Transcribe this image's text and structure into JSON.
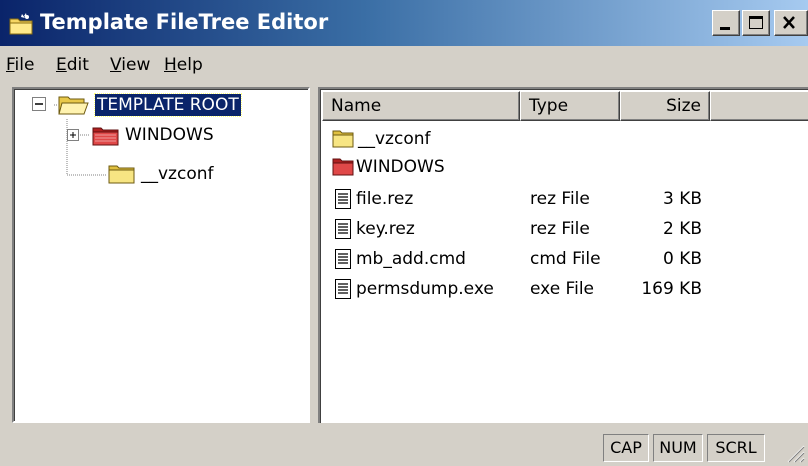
{
  "window": {
    "title": "Template FileTree Editor",
    "controls": {
      "minimize": "minimize",
      "maximize": "maximize",
      "close": "close"
    }
  },
  "menu": [
    {
      "label": "File",
      "hotkey": "F",
      "rest": "ile"
    },
    {
      "label": "Edit",
      "hotkey": "E",
      "rest": "dit"
    },
    {
      "label": "View",
      "hotkey": "V",
      "rest": "iew"
    },
    {
      "label": "Help",
      "hotkey": "H",
      "rest": "elp"
    }
  ],
  "tree": {
    "root": {
      "label": "TEMPLATE ROOT",
      "expanded": true,
      "selected": true,
      "icon": "folder-open-icon"
    },
    "children": [
      {
        "label": "WINDOWS",
        "expandable": true,
        "icon": "folder-red-icon"
      },
      {
        "label": "__vzconf",
        "expandable": false,
        "icon": "folder-icon"
      }
    ]
  },
  "list": {
    "columns": [
      {
        "label": "Name"
      },
      {
        "label": "Type"
      },
      {
        "label": "Size"
      }
    ],
    "rows": [
      {
        "name": "__vzconf",
        "type": "",
        "size": "",
        "icon": "folder-icon"
      },
      {
        "name": "WINDOWS",
        "type": "",
        "size": "",
        "icon": "folder-red-icon"
      },
      {
        "name": "file.rez",
        "type": "rez File",
        "size": "3 KB",
        "icon": "file-icon"
      },
      {
        "name": "key.rez",
        "type": "rez File",
        "size": "2 KB",
        "icon": "file-icon"
      },
      {
        "name": "mb_add.cmd",
        "type": "cmd File",
        "size": "0 KB",
        "icon": "file-icon"
      },
      {
        "name": "permsdump.exe",
        "type": "exe File",
        "size": "169 KB",
        "icon": "file-icon"
      }
    ]
  },
  "status": {
    "cap": "CAP",
    "num": "NUM",
    "scrl": "SCRL"
  },
  "colors": {
    "title_gradient_start": "#0a246a",
    "title_gradient_end": "#a6caf0",
    "selection": "#0a246a",
    "folder_yellow": "#f5e06b",
    "folder_red": "#d03030",
    "window_face": "#d4d0c8"
  }
}
